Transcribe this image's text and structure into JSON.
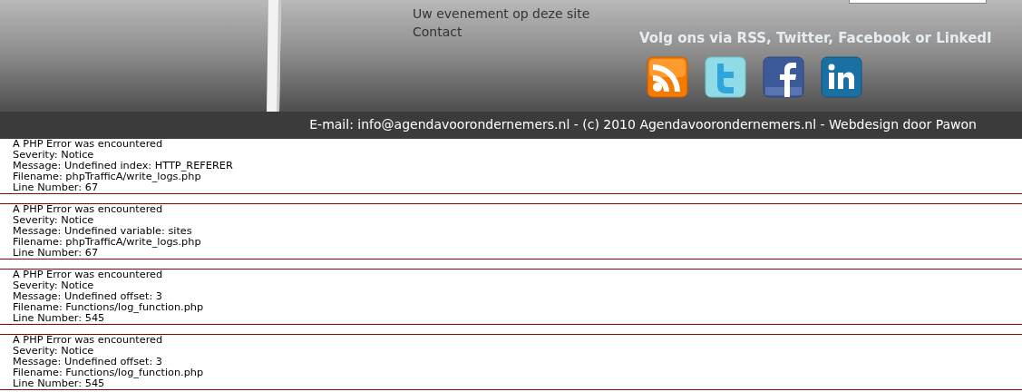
{
  "header": {
    "nav_links": [
      "Uw evenement op deze site",
      "Contact"
    ],
    "social": {
      "heading": "Volg ons via RSS, Twitter, Facebook or LinkedI",
      "icons": [
        {
          "kind": "rss"
        },
        {
          "kind": "twitter"
        },
        {
          "kind": "facebook"
        },
        {
          "kind": "linkedin"
        }
      ]
    }
  },
  "footer": {
    "text": "E-mail: info@agendavoorondernemers.nl - (c) 2010 Agendavoorondernemers.nl - Webdesign door Pawon"
  },
  "errors": [
    {
      "lines": [
        "A PHP Error was encountered",
        "Severity: Notice",
        "Message: Undefined index: HTTP_REFERER",
        "Filename: phpTrafficA/write_logs.php",
        "Line Number: 67"
      ]
    },
    {
      "lines": [
        "A PHP Error was encountered",
        "Severity: Notice",
        "Message: Undefined variable: sites",
        "Filename: phpTrafficA/write_logs.php",
        "Line Number: 67"
      ]
    },
    {
      "lines": [
        "A PHP Error was encountered",
        "Severity: Notice",
        "Message: Undefined offset: 3",
        "Filename: Functions/log_function.php",
        "Line Number: 545"
      ]
    },
    {
      "lines": [
        "A PHP Error was encountered",
        "Severity: Notice",
        "Message: Undefined offset: 3",
        "Filename: Functions/log_function.php",
        "Line Number: 545"
      ]
    }
  ]
}
